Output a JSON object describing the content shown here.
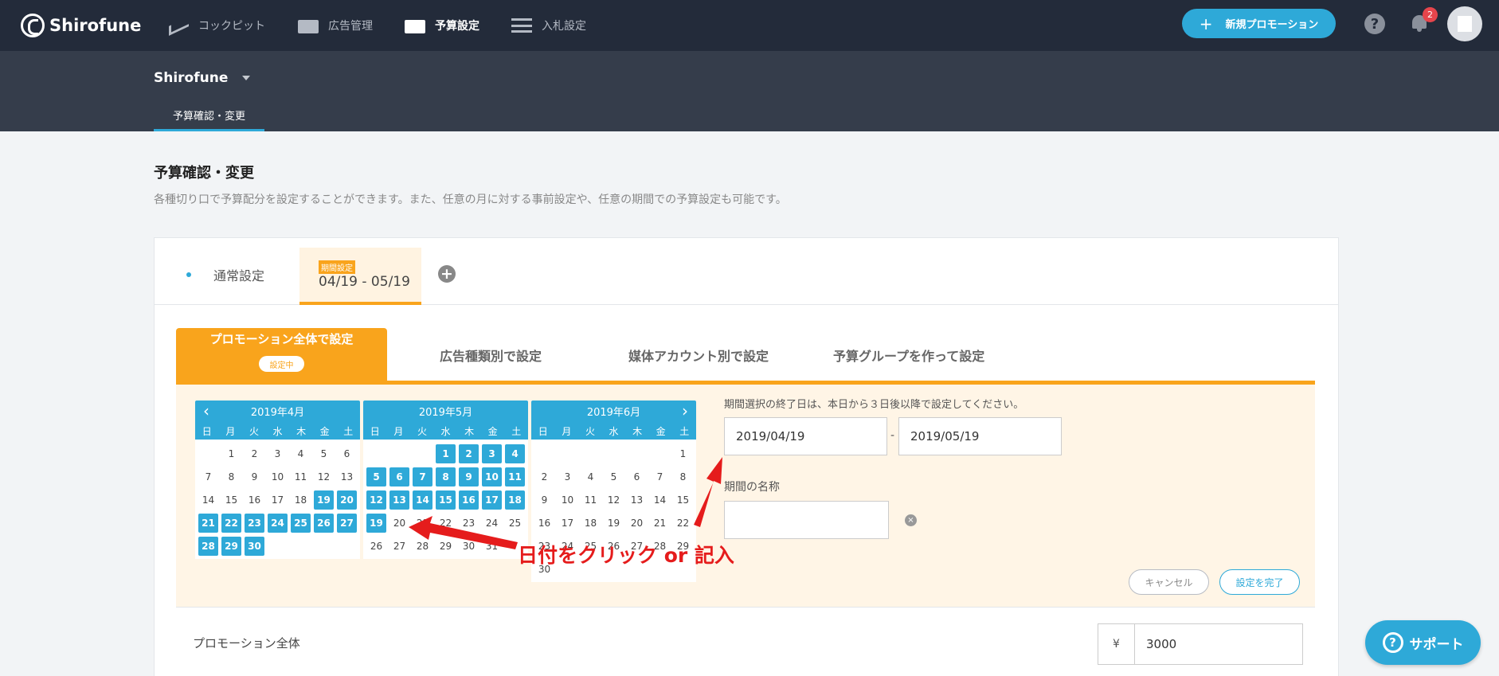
{
  "topnav": {
    "brand": "Shirofune",
    "items": [
      {
        "label": "コックピット",
        "icon": "trend-icon"
      },
      {
        "label": "広告管理",
        "icon": "folder-icon"
      },
      {
        "label": "予算設定",
        "icon": "wallet-icon"
      },
      {
        "label": "入札設定",
        "icon": "sliders-icon"
      }
    ],
    "new_promo_label": "新規プロモーション",
    "help": "?",
    "notification_count": "2"
  },
  "subheader": {
    "account": "Shirofune",
    "tab": "予算確認・変更"
  },
  "page": {
    "title": "予算確認・変更",
    "description": "各種切り口で予算配分を設定することができます。また、任意の月に対する事前設定や、任意の期間での予算設定も可能です。"
  },
  "tabs": {
    "normal": "通常設定",
    "period_tag": "期間設定",
    "period_range": "04/19 - 05/19",
    "add": "+"
  },
  "mode_tabs": {
    "active": "プロモーション全体で設定",
    "active_status": "設定中",
    "by_ad_type": "広告種類別で設定",
    "by_media_account": "媒体アカウント別で設定",
    "by_budget_group": "予算グループを作って設定"
  },
  "calendar": {
    "weekdays": [
      "日",
      "月",
      "火",
      "水",
      "木",
      "金",
      "土"
    ],
    "prev": "‹",
    "next": "›",
    "months": [
      {
        "title": "2019年4月",
        "offset": 1,
        "days": 30,
        "selected_from": 19,
        "selected_to": 30
      },
      {
        "title": "2019年5月",
        "offset": 3,
        "days": 31,
        "selected_from": 1,
        "selected_to": 19
      },
      {
        "title": "2019年6月",
        "offset": 6,
        "days": 30,
        "selected_from": 0,
        "selected_to": -1
      }
    ]
  },
  "period_form": {
    "hint": "期間選択の終了日は、本日から３日後以降で設定してください。",
    "start_date": "2019/04/19",
    "separator": "-",
    "end_date": "2019/05/19",
    "name_label": "期間の名称",
    "name_value": "",
    "clear": "×",
    "cancel_label": "キャンセル",
    "done_label": "設定を完了"
  },
  "annotation": "日付をクリック or 記入",
  "budget_row": {
    "label": "プロモーション全体",
    "currency": "¥",
    "amount": "3000"
  },
  "support": {
    "label": "サポート",
    "icon": "?"
  },
  "colors": {
    "nav_bg": "#232b3a",
    "accent_blue": "#2ea9d8",
    "accent_orange": "#f9a41c",
    "annotation_red": "#e51c1c"
  }
}
